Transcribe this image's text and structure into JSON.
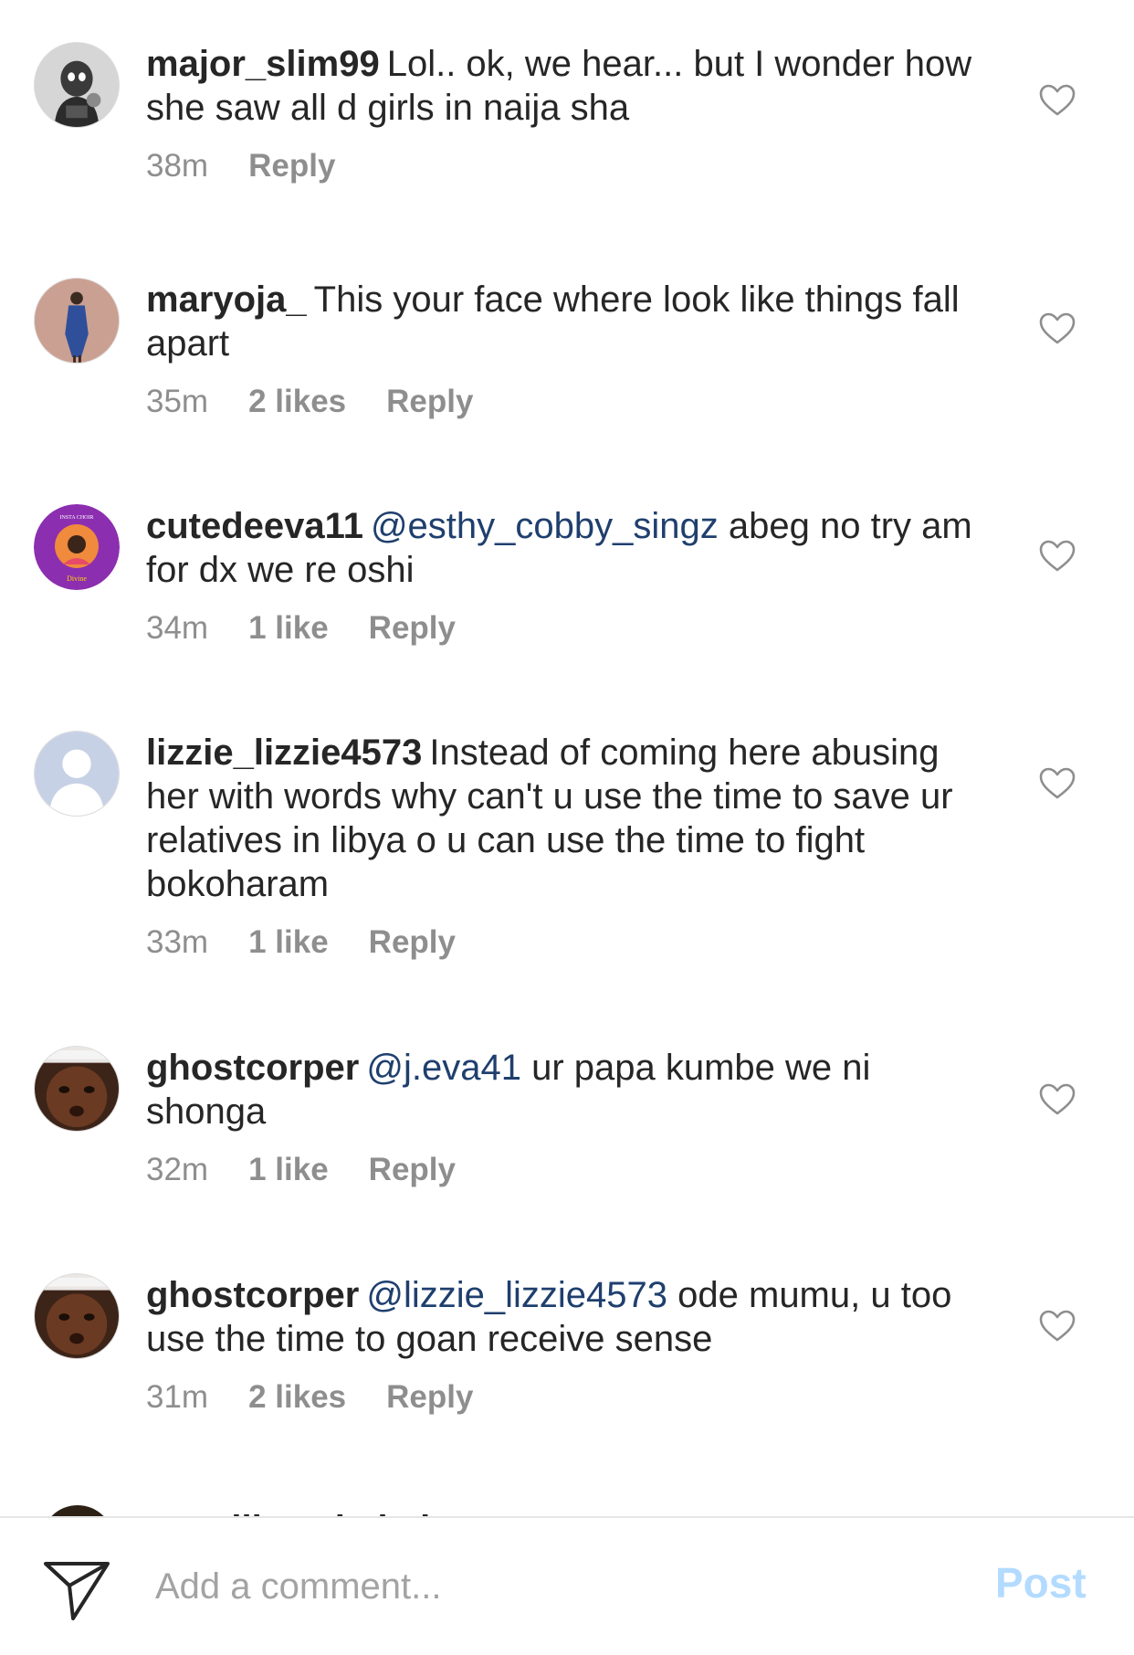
{
  "comments": [
    {
      "username": "major_slim99",
      "mention": "",
      "text": "Lol.. ok, we hear... but I wonder how she saw all d girls in naija sha",
      "time": "38m",
      "likes": "",
      "reply_label": "Reply",
      "avatar_icon": "cartoon-avatar-icon"
    },
    {
      "username": "maryoja_",
      "mention": "",
      "text": "This your face where look like things fall apart",
      "time": "35m",
      "likes": "2 likes",
      "reply_label": "Reply",
      "avatar_icon": "person-photo-avatar-icon"
    },
    {
      "username": "cutedeeva11",
      "mention": "@esthy_cobby_singz",
      "text": "abeg no try am for dx we re oshi",
      "time": "34m",
      "likes": "1 like",
      "reply_label": "Reply",
      "avatar_icon": "purple-badge-avatar-icon",
      "avatar_text_top": "INSTA CHOIR",
      "avatar_text_bottom": "Divine"
    },
    {
      "username": "lizzie_lizzie4573",
      "mention": "",
      "text": "Instead of coming here abusing her with words why can't u use the time to save ur relatives in libya o u can use the time to fight bokoharam",
      "time": "33m",
      "likes": "1 like",
      "reply_label": "Reply",
      "avatar_icon": "default-user-avatar-icon"
    },
    {
      "username": "ghostcorper",
      "mention": "@j.eva41",
      "text": "ur papa kumbe we ni shonga",
      "time": "32m",
      "likes": "1 like",
      "reply_label": "Reply",
      "avatar_icon": "face-photo-avatar-icon"
    },
    {
      "username": "ghostcorper",
      "mention": "@lizzie_lizzie4573",
      "text": "ode mumu, u too use the time to goan receive sense",
      "time": "31m",
      "likes": "2 likes",
      "reply_label": "Reply",
      "avatar_icon": "face-photo-avatar-icon"
    }
  ],
  "partial_comment": {
    "text": "emmiliana babel"
  },
  "bottom_bar": {
    "placeholder": "Add a comment...",
    "post_label": "Post",
    "send_icon": "paper-plane-icon"
  },
  "colors": {
    "text": "#262626",
    "meta": "#8e8e8e",
    "mention": "#1f3f6e",
    "post_disabled": "#b3dbff",
    "placeholder": "#a3a3a3"
  }
}
